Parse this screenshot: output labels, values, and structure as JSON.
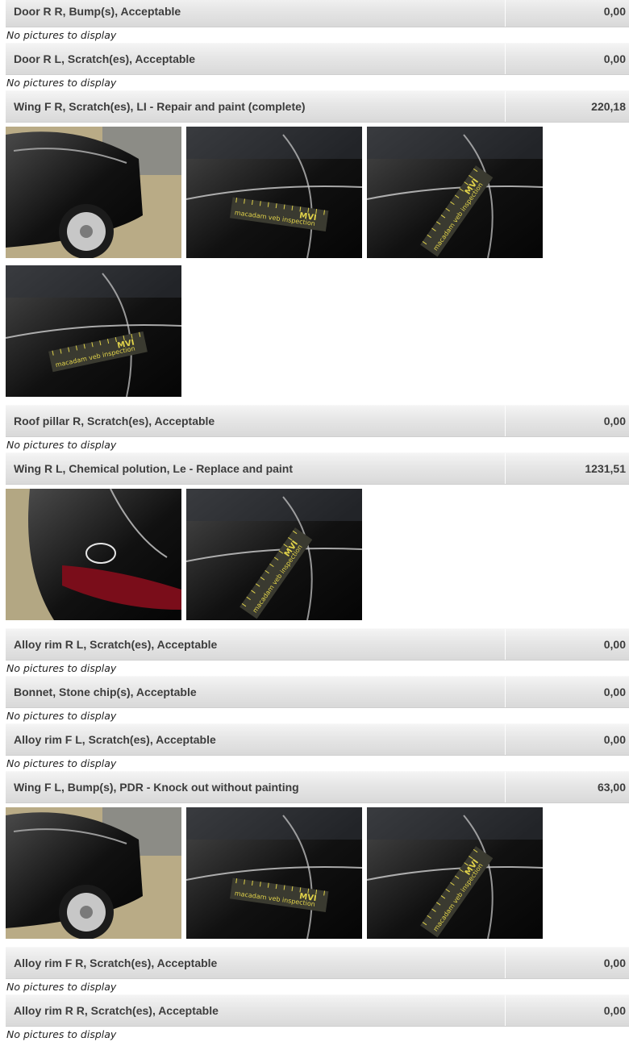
{
  "damage_list": [
    {
      "description": "Door R R, Bump(s), Acceptable",
      "amount": "0,00",
      "no_pictures_text": "No pictures to display",
      "photos": []
    },
    {
      "description": "Door R L, Scratch(es), Acceptable",
      "amount": "0,00",
      "no_pictures_text": "No pictures to display",
      "photos": []
    },
    {
      "description": "Wing F R, Scratch(es), LI - Repair and paint (complete)",
      "amount": "220,18",
      "photos": [
        "car-wheel-photo",
        "ruler-closeup-photo",
        "ruler-closeup-photo",
        "ruler-closeup-photo"
      ]
    },
    {
      "description": "Roof pillar R, Scratch(es), Acceptable",
      "amount": "0,00",
      "no_pictures_text": "No pictures to display",
      "photos": []
    },
    {
      "description": "Wing R L, Chemical polution, Le - Replace and paint",
      "amount": "1231,51",
      "photos": [
        "car-rear-photo",
        "ruler-closeup-photo"
      ]
    },
    {
      "description": "Alloy rim R L, Scratch(es), Acceptable",
      "amount": "0,00",
      "no_pictures_text": "No pictures to display",
      "photos": []
    },
    {
      "description": "Bonnet, Stone chip(s), Acceptable",
      "amount": "0,00",
      "no_pictures_text": "No pictures to display",
      "photos": []
    },
    {
      "description": "Alloy rim F L, Scratch(es), Acceptable",
      "amount": "0,00",
      "no_pictures_text": "No pictures to display",
      "photos": []
    },
    {
      "description": "Wing F L, Bump(s), PDR - Knock out without painting",
      "amount": "63,00",
      "photos": [
        "car-side-photo",
        "ruler-closeup-photo",
        "ruler-closeup-photo"
      ]
    },
    {
      "description": "Alloy rim F R, Scratch(es), Acceptable",
      "amount": "0,00",
      "no_pictures_text": "No pictures to display",
      "photos": []
    },
    {
      "description": "Alloy rim R R, Scratch(es), Acceptable",
      "amount": "0,00",
      "no_pictures_text": "No pictures to display",
      "photos": []
    }
  ],
  "ruler_text": "macadam veb inspection",
  "ruler_logo": "MVI",
  "colors": {
    "row_gradient_top": "#f4f4f4",
    "row_gradient_bottom": "#d9d9d9",
    "text": "#3d3d3d",
    "ruler": "#3a3a30",
    "ruler_text": "#e0d24a"
  }
}
